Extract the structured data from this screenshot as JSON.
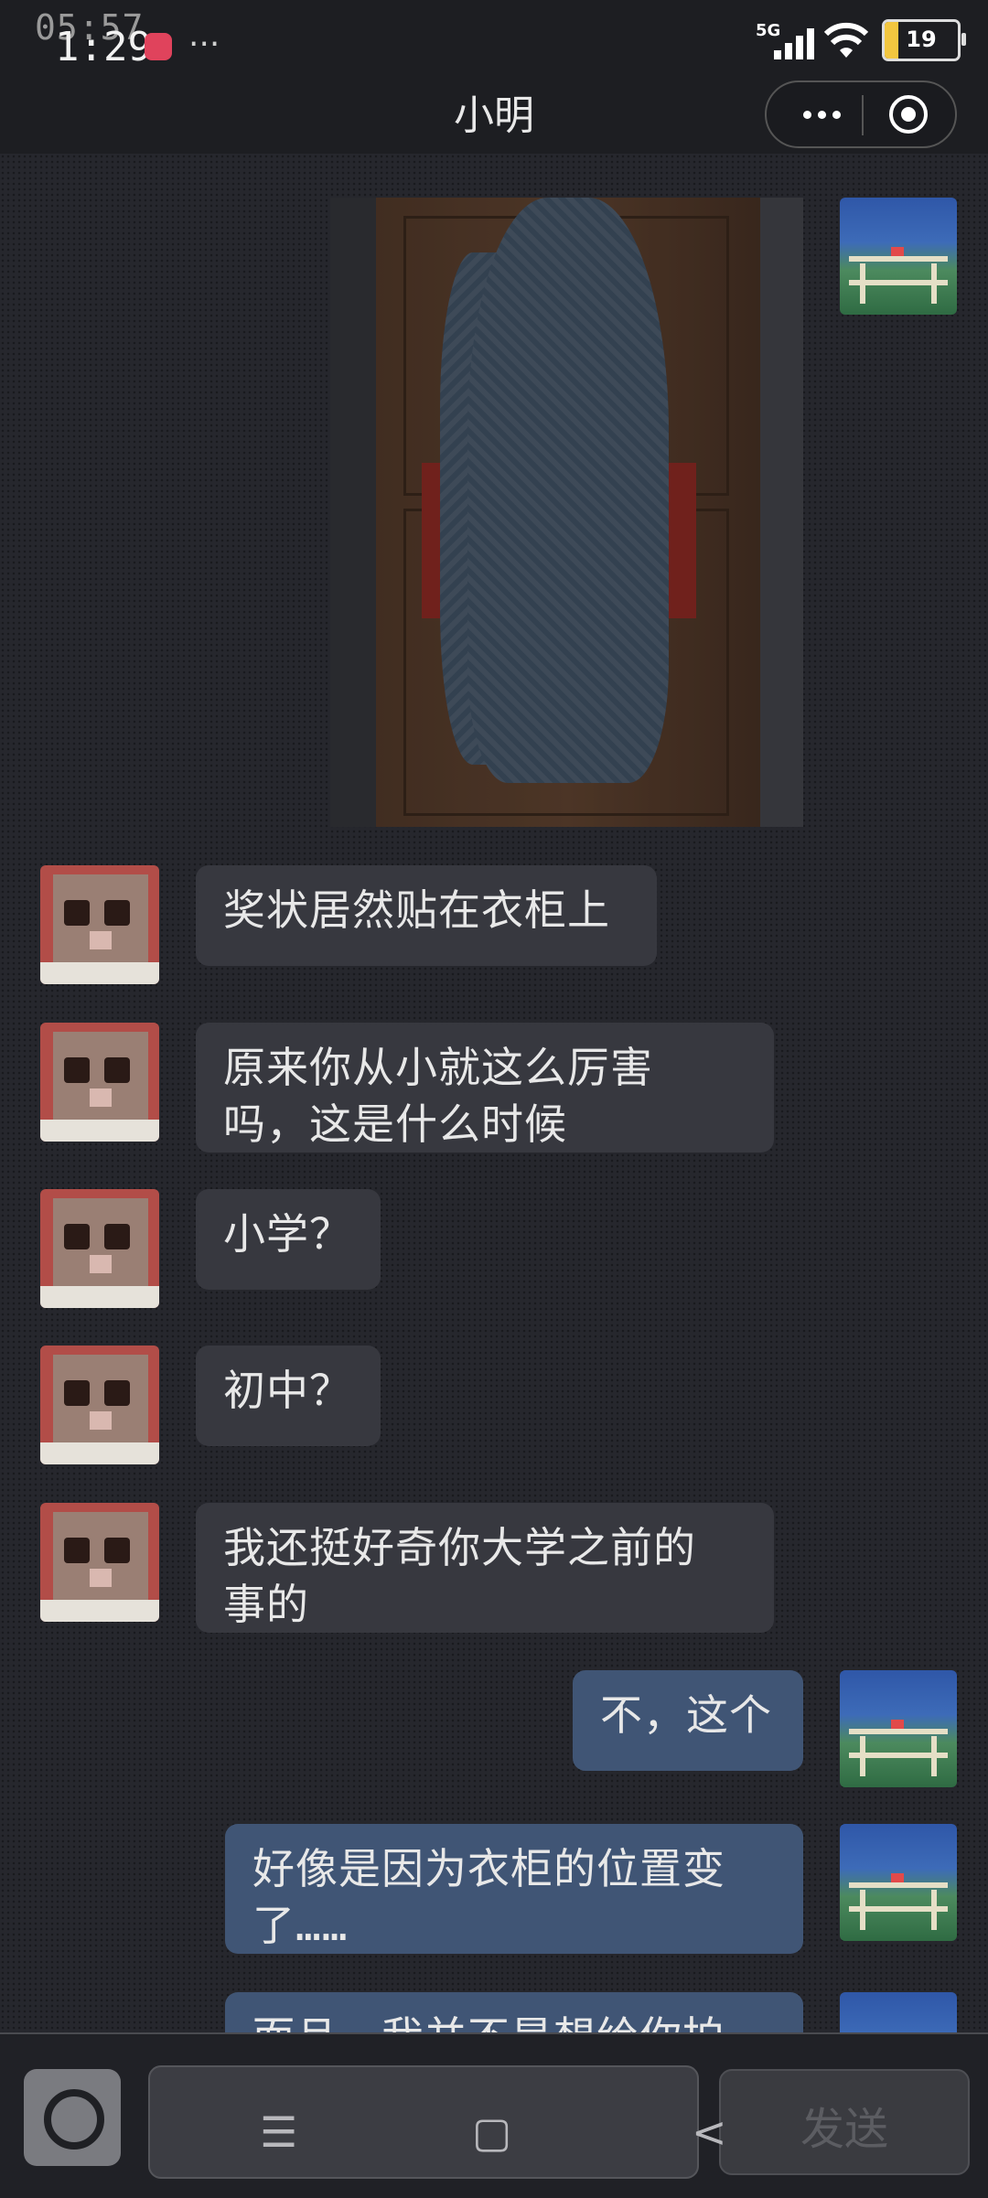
{
  "status_bar": {
    "time_ghost": "05:57",
    "time": "1:29",
    "more": "···",
    "network": "5G",
    "battery": "19",
    "battery_level": 0.19
  },
  "header": {
    "title": "小明",
    "icons": [
      "more-icon",
      "target-icon"
    ]
  },
  "messages": [
    {
      "side": "right",
      "type": "image",
      "description_icon": "photo"
    },
    {
      "side": "left",
      "text": "奖状居然贴在衣柜上"
    },
    {
      "side": "left",
      "text_line1": "原来你从小就这么厉害",
      "text_line2": "吗，这是什么时候"
    },
    {
      "side": "left",
      "text": "小学？"
    },
    {
      "side": "left",
      "text": "初中？"
    },
    {
      "side": "left",
      "text_line1": "我还挺好奇你大学之前的",
      "text_line2": "事的"
    },
    {
      "side": "right",
      "text": "不，这个"
    },
    {
      "side": "right",
      "text_line1": "好像是因为衣柜的位置变",
      "text_line2": "了……"
    },
    {
      "side": "right",
      "text": "而且，我并不是想给你拍"
    }
  ],
  "input_bar": {
    "send_label": "发送",
    "nav_menu": "☰",
    "nav_home": "▢",
    "nav_back": "<"
  },
  "colors": {
    "background": "#26272d",
    "bubble_left": "#37383f",
    "bubble_right": "#405575",
    "bar": "#1d1e22"
  }
}
